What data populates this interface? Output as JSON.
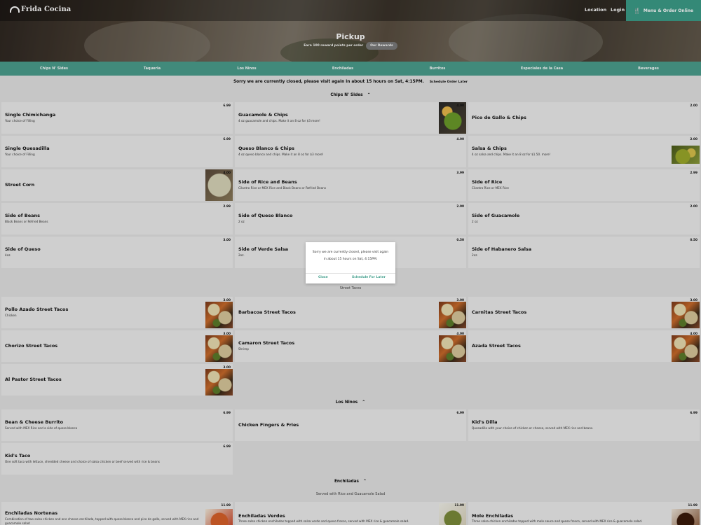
{
  "header": {
    "logo_text": "Frida Cocina",
    "nav": [
      {
        "label": "Location"
      },
      {
        "label": "Login"
      }
    ],
    "order_button": "Menu & Order Online",
    "hero_title": "Pickup",
    "hero_subtitle": "Earn 100 reward points per order",
    "rewards_button": "Our Rewards"
  },
  "categories": [
    {
      "label": "Chips N' Sides"
    },
    {
      "label": "Taqueria"
    },
    {
      "label": "Los Ninos"
    },
    {
      "label": "Enchiladas"
    },
    {
      "label": "Burritos"
    },
    {
      "label": "Especiales de la Casa"
    },
    {
      "label": "Beverages"
    }
  ],
  "banner": {
    "closed_text": "Sorry we are currently closed, please visit again in about 15 hours on Sat, 4:15PM.",
    "schedule_link": "Schedule Order Later"
  },
  "sections": {
    "chips": "Chips N' Sides",
    "street_tacos": "Street Tacos",
    "ninos": "Los Ninos",
    "enchiladas": "Enchiladas",
    "enchiladas_note": "Served with Rice and Guacamole Salad"
  },
  "items": {
    "single_chimichanga": {
      "name": "Single Chimichanga",
      "desc": "Your choice of Filling",
      "price": "6.99"
    },
    "guac_chips": {
      "name": "Guacamole & Chips",
      "desc": "4 oz guacamole and chips. Make it an 8 oz for $3 more!",
      "price": "4.00",
      "image": "guacamole-photo"
    },
    "pico_chips": {
      "name": "Pico de Gallo & Chips",
      "price": "2.00"
    },
    "single_quesadilla": {
      "name": "Single Quesadilla",
      "desc": "Your choice of Filling",
      "price": "6.99"
    },
    "queso_chips": {
      "name": "Queso Blanco & Chips",
      "desc": "4 oz queso blanco and chips. Make it an 8 oz for $3 more!",
      "price": "4.00"
    },
    "salsa_chips": {
      "name": "Salsa & Chips",
      "desc": "4 oz salsa and chips. Make it an 8 oz for $1.50. more!",
      "price": "2.00",
      "image": "salsa-photo"
    },
    "street_corn": {
      "name": "Street Corn",
      "price": "4.00",
      "image": "street-corn-photo"
    },
    "rice_beans": {
      "name": "Side of Rice and Beans",
      "desc": "Cilantro Rice or MEX Rice and Black Beans or Refried Beans",
      "price": "3.99"
    },
    "side_rice": {
      "name": "Side of Rice",
      "desc": "Cilantro Rice or MEX Rice",
      "price": "2.99"
    },
    "side_beans": {
      "name": "Side of Beans",
      "desc": "Black Beans or Refried Beans",
      "price": "2.99"
    },
    "side_queso_blanco": {
      "name": "Side of Queso Blanco",
      "desc": "2 oz",
      "price": "2.00"
    },
    "side_guac": {
      "name": "Side of Guacamole",
      "desc": "2 oz",
      "price": "2.00"
    },
    "side_queso": {
      "name": "Side of Queso",
      "desc": "4oz.",
      "price": "3.00"
    },
    "side_verde": {
      "name": "Side of Verde Salsa",
      "desc": "2oz.",
      "price": "0.50"
    },
    "side_habanero": {
      "name": "Side of Habanero Salsa",
      "desc": "2oz.",
      "price": "0.50"
    },
    "pollo_tacos": {
      "name": "Pollo Azado Street Tacos",
      "desc": "Chicken",
      "price": "3.00",
      "image": "taco-photo"
    },
    "barbacoa_tacos": {
      "name": "Barbacoa Street Tacos",
      "price": "3.00",
      "image": "taco-photo"
    },
    "carnitas_tacos": {
      "name": "Carnitas Street Tacos",
      "price": "3.00",
      "image": "taco-photo"
    },
    "chorizo_tacos": {
      "name": "Chorizo Street Tacos",
      "price": "3.00",
      "image": "taco-photo"
    },
    "camaron_tacos": {
      "name": "Camaron Street Tacos",
      "desc": "Shrimp",
      "price": "4.00",
      "image": "taco-photo"
    },
    "azada_tacos": {
      "name": "Azada Street Tacos",
      "price": "4.00",
      "image": "taco-photo"
    },
    "pastor_tacos": {
      "name": "Al Pastor Street Tacos",
      "price": "3.00",
      "image": "taco-photo"
    },
    "bean_burrito": {
      "name": "Bean & Cheese Burrito",
      "desc": "Served with MEX Rice and a side of queso blanco",
      "price": "6.99"
    },
    "chicken_fingers": {
      "name": "Chicken Fingers & Fries",
      "price": "6.99"
    },
    "kids_dilla": {
      "name": "Kid's Dilla",
      "desc": "Quesadilla with your choice of chicken or cheese, served with MEX rice and beans.",
      "price": "6.99"
    },
    "kids_taco": {
      "name": "Kid's Taco",
      "desc": "One soft taco with lettuce, shredded cheese and choice of salsa chicken or beef served with rice & beans",
      "price": "6.99"
    },
    "ench_nortenas": {
      "name": "Enchiladas Nortenas",
      "desc": "Combination of two salsa chicken and one cheese enchilada, topped with queso blanco and pico de gallo, served with MEX rice and guacamole salad",
      "price": "11.99",
      "image": "enchilada-photo"
    },
    "ench_verdes": {
      "name": "Enchiladas Verdes",
      "desc": "Three salsa chicken enchiladas topped with salsa verde and queso fresco, served with MEX rice & guacamole salad.",
      "price": "11.99",
      "image": "enchilada-verde-photo"
    },
    "mole_ench": {
      "name": "Mole Enchiladas",
      "desc": "Three salsa chicken enchiladas topped with mole sauce and queso fresco, served with MEX rice & guacamole salad.",
      "price": "11.99",
      "image": "mole-photo"
    }
  },
  "modal": {
    "message": "Sorry we are currently closed, please visit again in about 15 hours on Sat, 4:15PM.",
    "close": "Close",
    "schedule": "Schedule For Later"
  },
  "colors": {
    "accent": "#3c9c88",
    "category_bar": "#4b9e8d",
    "card": "#ececec",
    "page": "#e2e2e2"
  }
}
